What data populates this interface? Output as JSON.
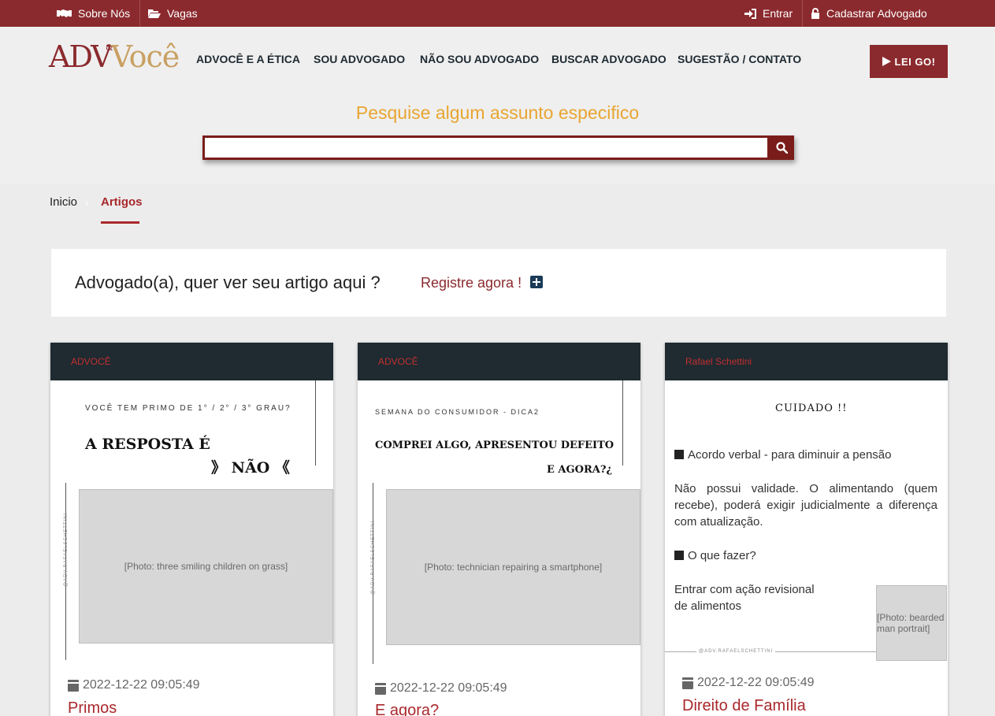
{
  "topbar": {
    "about": "Sobre Nós",
    "jobs": "Vagas",
    "login": "Entrar",
    "register_lawyer": "Cadastrar Advogado"
  },
  "header": {
    "logo_adv": "ADV",
    "logo_amp": "&",
    "logo_voce": "Você",
    "nav": [
      "ADVOCÊ E A ÉTICA",
      "SOU ADVOGADO",
      "NÃO SOU ADVOGADO",
      "BUSCAR ADVOGADO",
      "SUGESTÃO / CONTATO"
    ],
    "cta": "LEI GO!"
  },
  "search": {
    "title": "Pesquise algum assunto especifico",
    "value": ""
  },
  "breadcrumb": {
    "home": "Inicio",
    "current": "Artigos"
  },
  "register_box": {
    "question": "Advogado(a), quer ver seu artigo aqui ?",
    "link": "Registre agora !"
  },
  "cards": [
    {
      "author": "ADVOCÊ",
      "img_sub": "VOCÊ TEM PRIMO DE 1° / 2° / 3° GRAU?",
      "img_line1": "A RESPOSTA É",
      "img_line2": "》 NÃO 《",
      "img_side": "@ADV.RAFAELSCHETTINI",
      "img_photo": "[Photo: three smiling children on grass]",
      "date": "2022-12-22 09:05:49",
      "title": "Primos"
    },
    {
      "author": "ADVOCÊ",
      "img_sub": "SEMANA DO CONSUMIDOR - DICA2",
      "img_line1": "COMPREI ALGO, APRESENTOU DEFEITO",
      "img_line2": "E AGORA?¿",
      "img_side": "@ADV.RAFAELSCHETTINI",
      "img_photo": "[Photo: technician repairing a smartphone]",
      "date": "2022-12-22 09:05:49",
      "title": "E agora?"
    },
    {
      "author": "Rafael Schettini",
      "img_title": "CUIDADO !!",
      "img_p1": "Acordo verbal - para diminuir a pensão",
      "img_p2": "Não possui validade. O alimentando (quem recebe), poderá exigir judicialmente a diferença com atualização.",
      "img_p3": "O que fazer?",
      "img_p4a": "Entrar com ação revisional",
      "img_p4b": "de alimentos",
      "img_footer": "@ADV.RAFAELSCHETTINI",
      "img_photo": "[Photo: bearded man portrait]",
      "date": "2022-12-22 09:05:49",
      "title": "Direito de Família"
    }
  ],
  "colors": {
    "brand": "#8b2a2e",
    "accent": "#e8a531",
    "card_head": "#1f2a31"
  }
}
